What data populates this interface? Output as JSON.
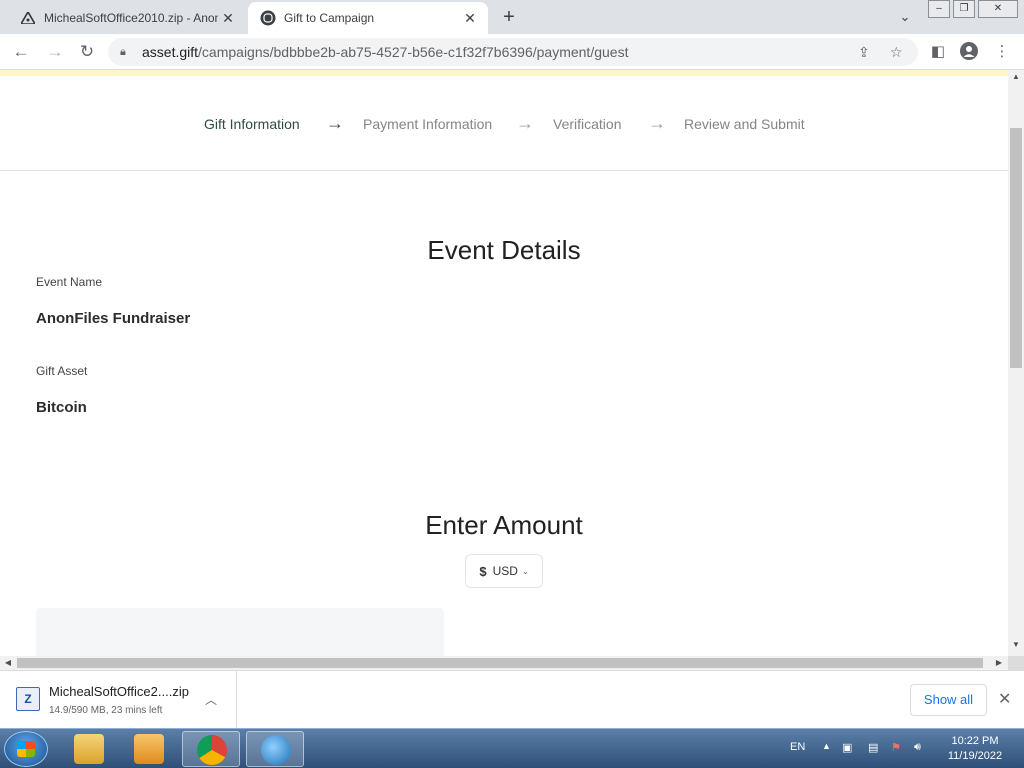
{
  "browser": {
    "tabs": [
      {
        "title": "MichealSoftOffice2010.zip - Anon",
        "active": false
      },
      {
        "title": "Gift to Campaign",
        "active": true
      }
    ],
    "url_host": "asset.gift",
    "url_path": "/campaigns/bdbbbe2b-ab75-4527-b56e-c1f32f7b6396/payment/guest"
  },
  "stepper": {
    "steps": [
      "Gift Information",
      "Payment Information",
      "Verification",
      "Review and Submit"
    ],
    "current_step_index": 0
  },
  "event_details": {
    "heading": "Event Details",
    "event_name_label": "Event Name",
    "event_name_value": "AnonFiles Fundraiser",
    "gift_asset_label": "Gift Asset",
    "gift_asset_value": "Bitcoin"
  },
  "amount": {
    "heading": "Enter Amount",
    "currency_symbol": "$",
    "currency_code": "USD"
  },
  "download": {
    "filename": "MichealSoftOffice2....zip",
    "status": "14.9/590 MB, 23 mins left",
    "show_all_label": "Show all"
  },
  "taskbar": {
    "language": "EN",
    "time": "10:22 PM",
    "date": "11/19/2022"
  },
  "colors": {
    "stepper_active": "#2f4a3f",
    "stepper_inactive": "#80868b",
    "banner": "#fdf6c5",
    "link_blue": "#1a73e8"
  }
}
